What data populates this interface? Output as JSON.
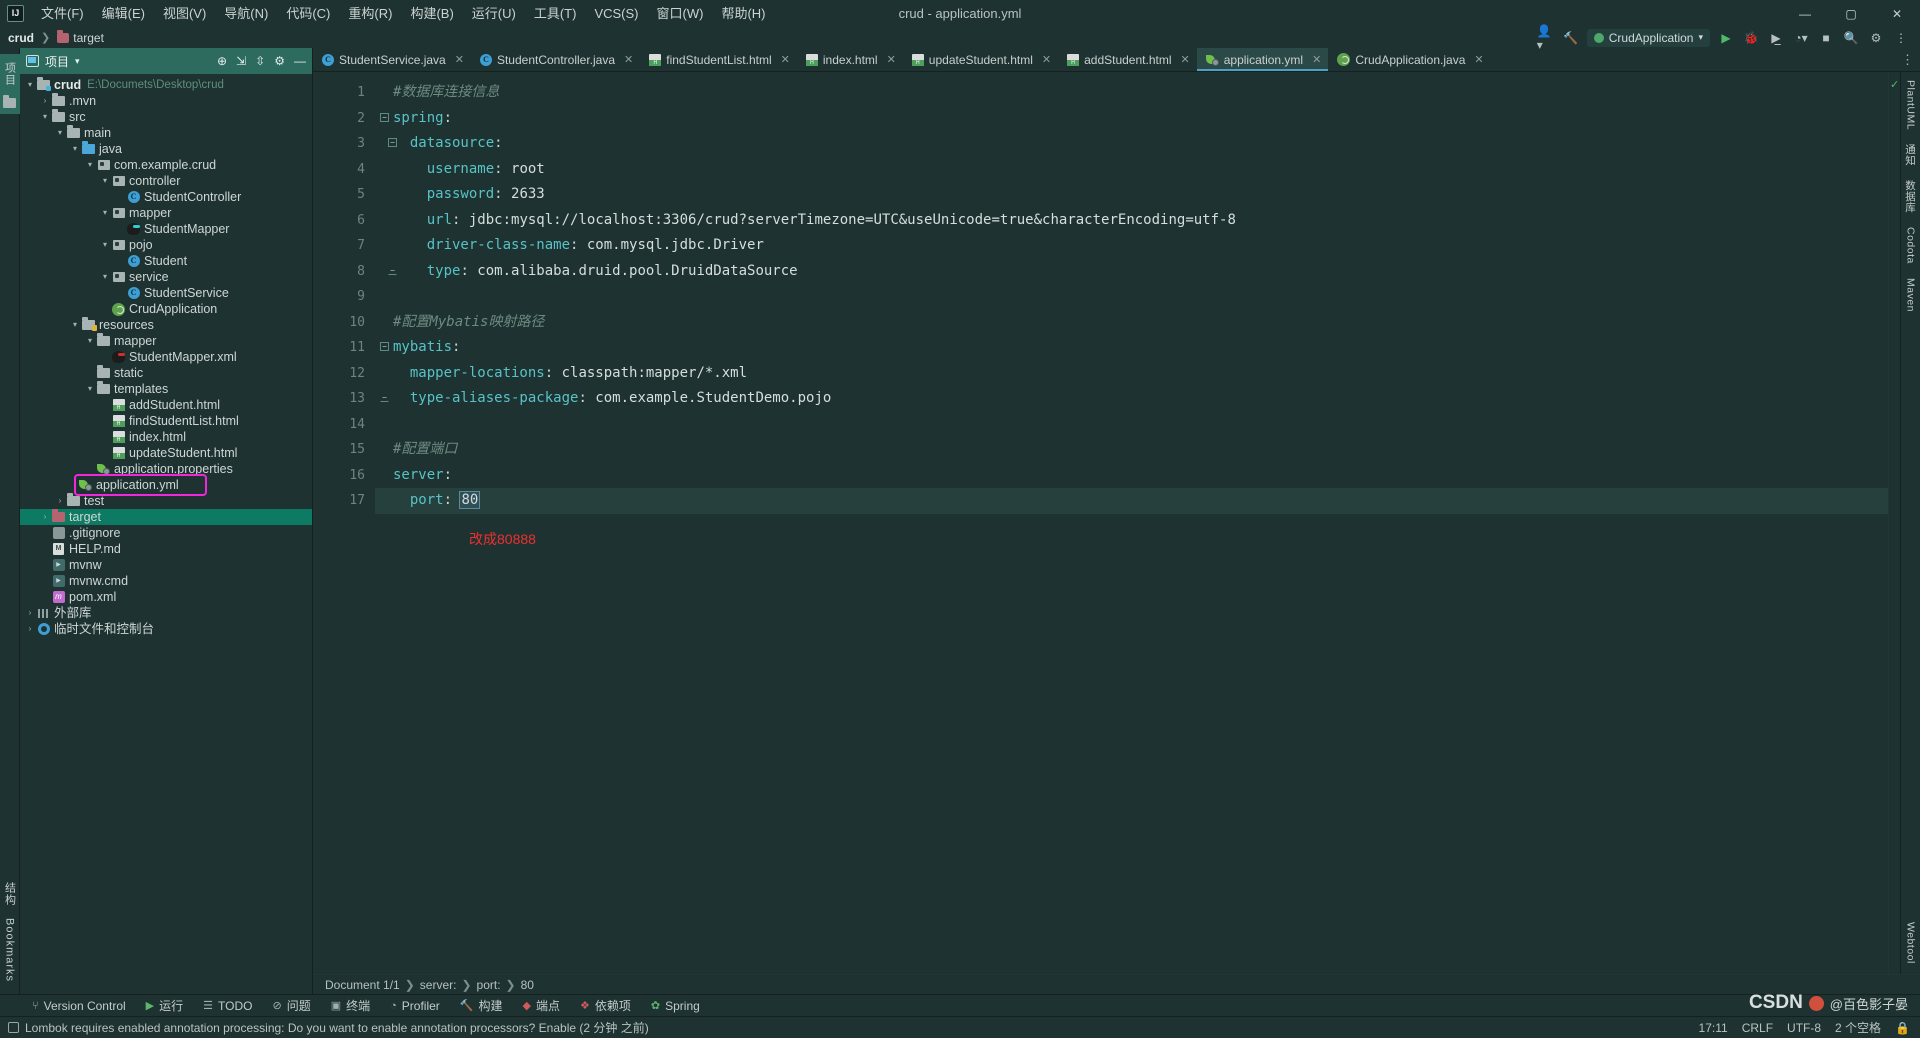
{
  "window": {
    "title": "crud - application.yml",
    "logo_text": "IJ",
    "controls": {
      "minimize": "—",
      "maximize": "▢",
      "close": "✕"
    }
  },
  "menu": [
    {
      "label": "文件(F)",
      "name": "menu-file"
    },
    {
      "label": "编辑(E)",
      "name": "menu-edit"
    },
    {
      "label": "视图(V)",
      "name": "menu-view"
    },
    {
      "label": "导航(N)",
      "name": "menu-navigate"
    },
    {
      "label": "代码(C)",
      "name": "menu-code"
    },
    {
      "label": "重构(R)",
      "name": "menu-refactor"
    },
    {
      "label": "构建(B)",
      "name": "menu-build"
    },
    {
      "label": "运行(U)",
      "name": "menu-run"
    },
    {
      "label": "工具(T)",
      "name": "menu-tools"
    },
    {
      "label": "VCS(S)",
      "name": "menu-vcs"
    },
    {
      "label": "窗口(W)",
      "name": "menu-window"
    },
    {
      "label": "帮助(H)",
      "name": "menu-help"
    }
  ],
  "navbar": {
    "crumbs": [
      "crud",
      "target"
    ],
    "run_config": "CrudApplication",
    "icons": [
      "user-icon",
      "chevron-down-icon",
      "hammer-icon",
      "run-icon",
      "debug-icon",
      "run-with-coverage-icon",
      "profiler-icon",
      "stop-icon",
      "search-everywhere-icon",
      "settings-icon",
      "more-icon"
    ]
  },
  "project_panel": {
    "title": "项目",
    "rail_label": "项目",
    "header_icons": [
      "locate-icon",
      "collapse-all-icon",
      "expand-icon",
      "settings-icon",
      "hide-icon"
    ],
    "tree": [
      {
        "depth": 0,
        "arrow": "▾",
        "icon": "module-folder",
        "label": "crud",
        "bold": true,
        "note": "E:\\Documets\\Desktop\\crud"
      },
      {
        "depth": 1,
        "arrow": "›",
        "icon": "folder",
        "label": ".mvn"
      },
      {
        "depth": 1,
        "arrow": "▾",
        "icon": "folder",
        "label": "src"
      },
      {
        "depth": 2,
        "arrow": "▾",
        "icon": "folder",
        "label": "main"
      },
      {
        "depth": 3,
        "arrow": "▾",
        "icon": "source-folder",
        "label": "java"
      },
      {
        "depth": 4,
        "arrow": "▾",
        "icon": "package",
        "label": "com.example.crud"
      },
      {
        "depth": 5,
        "arrow": "▾",
        "icon": "package",
        "label": "controller"
      },
      {
        "depth": 6,
        "arrow": "",
        "icon": "class",
        "label": "StudentController"
      },
      {
        "depth": 5,
        "arrow": "▾",
        "icon": "package",
        "label": "mapper"
      },
      {
        "depth": 6,
        "arrow": "",
        "icon": "mybatis-cyan",
        "label": "StudentMapper"
      },
      {
        "depth": 5,
        "arrow": "▾",
        "icon": "package",
        "label": "pojo"
      },
      {
        "depth": 6,
        "arrow": "",
        "icon": "class",
        "label": "Student"
      },
      {
        "depth": 5,
        "arrow": "▾",
        "icon": "package",
        "label": "service"
      },
      {
        "depth": 6,
        "arrow": "",
        "icon": "class",
        "label": "StudentService"
      },
      {
        "depth": 5,
        "arrow": "",
        "icon": "spring-class",
        "label": "CrudApplication"
      },
      {
        "depth": 3,
        "arrow": "▾",
        "icon": "resource-folder",
        "label": "resources"
      },
      {
        "depth": 4,
        "arrow": "▾",
        "icon": "folder",
        "label": "mapper"
      },
      {
        "depth": 5,
        "arrow": "",
        "icon": "mybatis",
        "label": "StudentMapper.xml"
      },
      {
        "depth": 4,
        "arrow": "",
        "icon": "folder",
        "label": "static"
      },
      {
        "depth": 4,
        "arrow": "▾",
        "icon": "folder",
        "label": "templates"
      },
      {
        "depth": 5,
        "arrow": "",
        "icon": "html",
        "label": "addStudent.html"
      },
      {
        "depth": 5,
        "arrow": "",
        "icon": "html",
        "label": "findStudentList.html"
      },
      {
        "depth": 5,
        "arrow": "",
        "icon": "html",
        "label": "index.html"
      },
      {
        "depth": 5,
        "arrow": "",
        "icon": "html",
        "label": "updateStudent.html"
      },
      {
        "depth": 4,
        "arrow": "",
        "icon": "spring-leaf",
        "label": "application.properties"
      },
      {
        "depth": 4,
        "arrow": "",
        "icon": "spring-leaf",
        "label": "application.yml",
        "highlight": true
      },
      {
        "depth": 2,
        "arrow": "›",
        "icon": "folder",
        "label": "test"
      },
      {
        "depth": 1,
        "arrow": "›",
        "icon": "folder-pink",
        "label": "target",
        "selected": true
      },
      {
        "depth": 1,
        "arrow": "",
        "icon": "git",
        "label": ".gitignore"
      },
      {
        "depth": 1,
        "arrow": "",
        "icon": "md",
        "label": "HELP.md"
      },
      {
        "depth": 1,
        "arrow": "",
        "icon": "script",
        "label": "mvnw"
      },
      {
        "depth": 1,
        "arrow": "",
        "icon": "script",
        "label": "mvnw.cmd"
      },
      {
        "depth": 1,
        "arrow": "",
        "icon": "maven",
        "label": "pom.xml"
      },
      {
        "depth": 0,
        "arrow": "›",
        "icon": "library",
        "label": "外部库"
      },
      {
        "depth": 0,
        "arrow": "›",
        "icon": "console",
        "label": "临时文件和控制台"
      }
    ]
  },
  "editor": {
    "tabs": [
      {
        "label": "StudentService.java",
        "icon": "class-icon",
        "active": false
      },
      {
        "label": "StudentController.java",
        "icon": "class-icon",
        "active": false
      },
      {
        "label": "findStudentList.html",
        "icon": "html-icon",
        "active": false
      },
      {
        "label": "index.html",
        "icon": "html-icon",
        "active": false
      },
      {
        "label": "updateStudent.html",
        "icon": "html-icon",
        "active": false
      },
      {
        "label": "addStudent.html",
        "icon": "html-icon",
        "active": false
      },
      {
        "label": "application.yml",
        "icon": "spring-leaf-icon",
        "active": true
      },
      {
        "label": "CrudApplication.java",
        "icon": "spring-class-icon",
        "active": false
      }
    ],
    "line_numbers": [
      "1",
      "2",
      "3",
      "4",
      "5",
      "6",
      "7",
      "8",
      "9",
      "10",
      "11",
      "12",
      "13",
      "14",
      "15",
      "16",
      "17"
    ],
    "lines": [
      {
        "n": 1,
        "type": "comment",
        "text": "#数据库连接信息"
      },
      {
        "n": 2,
        "type": "kv",
        "indent": 0,
        "key": "spring",
        "value": ""
      },
      {
        "n": 3,
        "type": "kv",
        "indent": 1,
        "key": "datasource",
        "value": ""
      },
      {
        "n": 4,
        "type": "kv",
        "indent": 2,
        "key": "username",
        "value": "root"
      },
      {
        "n": 5,
        "type": "kv",
        "indent": 2,
        "key": "password",
        "value": "2633"
      },
      {
        "n": 6,
        "type": "kv",
        "indent": 2,
        "key": "url",
        "value": "jdbc:mysql://localhost:3306/crud?serverTimezone=UTC&useUnicode=true&characterEncoding=utf-8"
      },
      {
        "n": 7,
        "type": "kv",
        "indent": 2,
        "key": "driver-class-name",
        "value": "com.mysql.jdbc.Driver"
      },
      {
        "n": 8,
        "type": "kv",
        "indent": 2,
        "key": "type",
        "value": "com.alibaba.druid.pool.DruidDataSource"
      },
      {
        "n": 9,
        "type": "blank",
        "text": ""
      },
      {
        "n": 10,
        "type": "comment",
        "text": "#配置Mybatis映射路径"
      },
      {
        "n": 11,
        "type": "kv",
        "indent": 0,
        "key": "mybatis",
        "value": ""
      },
      {
        "n": 12,
        "type": "kv",
        "indent": 1,
        "key": "mapper-locations",
        "value": "classpath:mapper/*.xml"
      },
      {
        "n": 13,
        "type": "kv",
        "indent": 1,
        "key": "type-aliases-package",
        "value": "com.example.StudentDemo.pojo"
      },
      {
        "n": 14,
        "type": "blank",
        "text": ""
      },
      {
        "n": 15,
        "type": "comment",
        "text": "#配置端口"
      },
      {
        "n": 16,
        "type": "kv",
        "indent": 0,
        "key": "server",
        "value": ""
      },
      {
        "n": 17,
        "type": "kv-selected",
        "indent": 1,
        "key": "port",
        "value": "80",
        "current": true
      }
    ],
    "annotation": "改成80888",
    "annotation_color": "#ef2f2f",
    "highlight_color": "#ef28d8",
    "breadcrumb": [
      "Document 1/1",
      "server:",
      "port:",
      "80"
    ],
    "right_rail": [
      "PlantUML",
      "通知",
      "数据库",
      "Codota",
      "Maven"
    ],
    "inspection_status": "✓"
  },
  "bottom_toolwindows": [
    {
      "label": "Version Control",
      "icon": "branch-icon"
    },
    {
      "label": "运行",
      "icon": "run-icon"
    },
    {
      "label": "TODO",
      "icon": "todo-icon"
    },
    {
      "label": "问题",
      "icon": "problems-icon"
    },
    {
      "label": "终端",
      "icon": "terminal-icon"
    },
    {
      "label": "Profiler",
      "icon": "profiler-icon"
    },
    {
      "label": "构建",
      "icon": "build-icon"
    },
    {
      "label": "端点",
      "icon": "endpoints-icon"
    },
    {
      "label": "依赖项",
      "icon": "dependencies-icon"
    },
    {
      "label": "Spring",
      "icon": "spring-icon"
    }
  ],
  "left_rail_bottom": [
    "结构",
    "Bookmarks"
  ],
  "right_rail_bottom": [
    "Webtool"
  ],
  "statusbar": {
    "message": "Lombok requires enabled annotation processing: Do you want to enable annotation processors? Enable (2 分钟 之前)",
    "time": "17:11",
    "line_sep": "CRLF",
    "encoding": "UTF-8",
    "indent": "2 个空格",
    "lock": "🔒"
  },
  "watermark": {
    "brand": "CSDN",
    "handle": "@百色影子晏"
  }
}
